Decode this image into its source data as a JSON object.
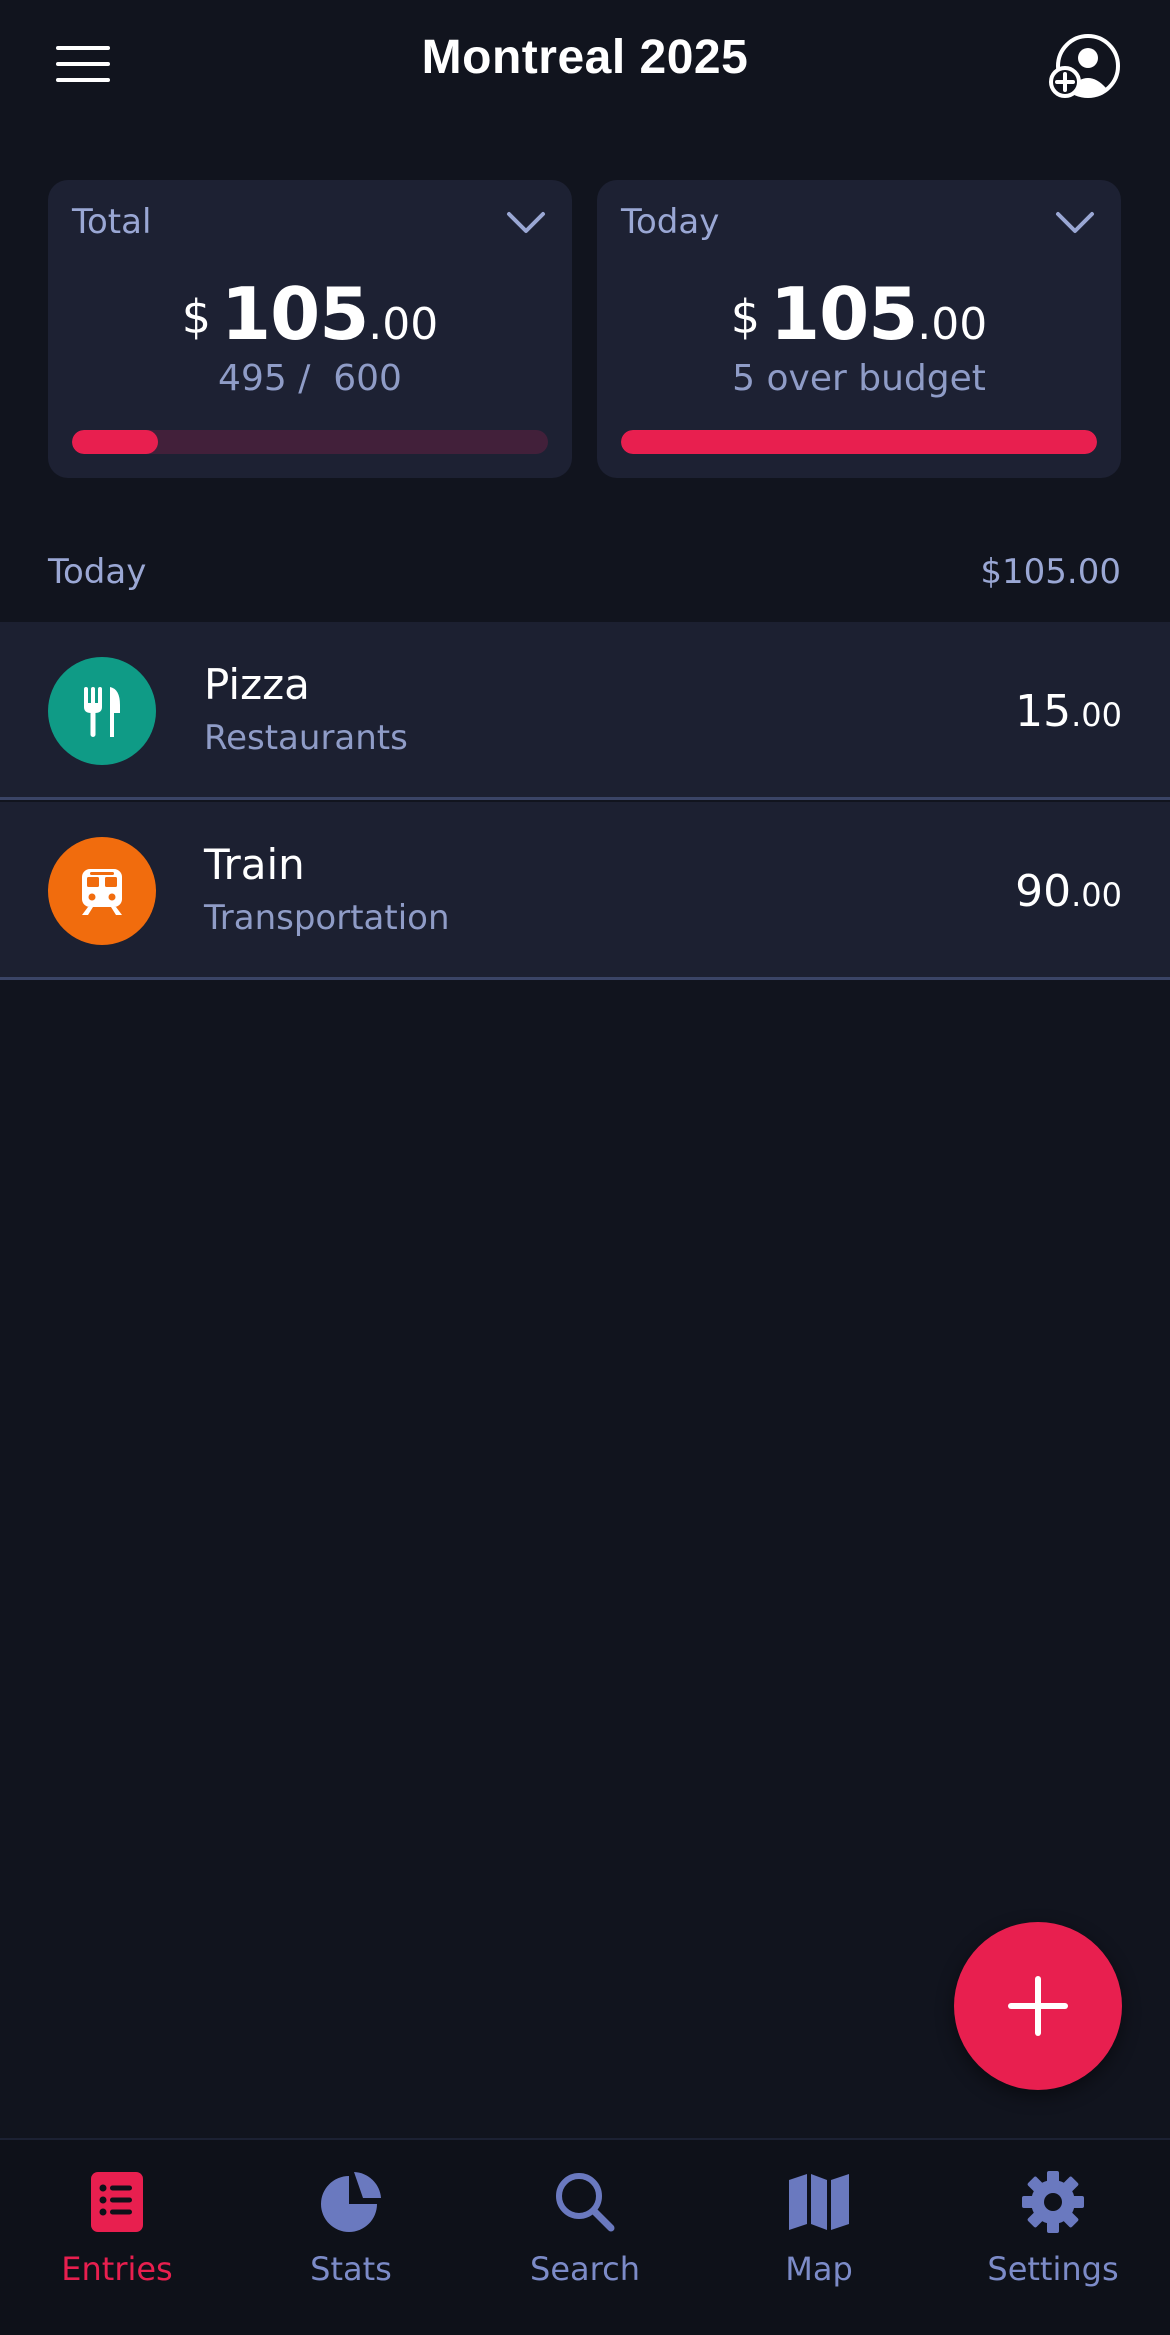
{
  "header": {
    "title": "Montreal 2025",
    "menu_icon": "hamburger-menu-icon",
    "profile_icon": "add-user-icon"
  },
  "summary": {
    "total": {
      "label": "Total",
      "currency": "$",
      "amount_int": "105",
      "amount_dec": ".00",
      "sub": "495 /  600",
      "progress": 0.18
    },
    "today": {
      "label": "Today",
      "currency": "$",
      "amount_int": "105",
      "amount_dec": ".00",
      "sub": "5 over budget",
      "progress": 1.0
    }
  },
  "section": {
    "label": "Today",
    "total": "$105.00"
  },
  "entries": [
    {
      "name": "Pizza",
      "category": "Restaurants",
      "amount_int": "15",
      "amount_dec": ".00",
      "icon": "fork-knife-icon",
      "color": "#0f9b86"
    },
    {
      "name": "Train",
      "category": "Transportation",
      "amount_int": "90",
      "amount_dec": ".00",
      "icon": "train-icon",
      "color": "#f16c0d"
    }
  ],
  "fab": {
    "icon": "plus-icon"
  },
  "nav": [
    {
      "label": "Entries",
      "icon": "list-icon",
      "active": true
    },
    {
      "label": "Stats",
      "icon": "pie-chart-icon",
      "active": false
    },
    {
      "label": "Search",
      "icon": "search-icon",
      "active": false
    },
    {
      "label": "Map",
      "icon": "map-icon",
      "active": false
    },
    {
      "label": "Settings",
      "icon": "gear-icon",
      "active": false
    }
  ],
  "colors": {
    "background": "#11141e",
    "card": "#1d2133",
    "accent": "#e81f4f",
    "muted_text": "#8f9cc7",
    "nav_inactive": "#7c8bc8"
  }
}
